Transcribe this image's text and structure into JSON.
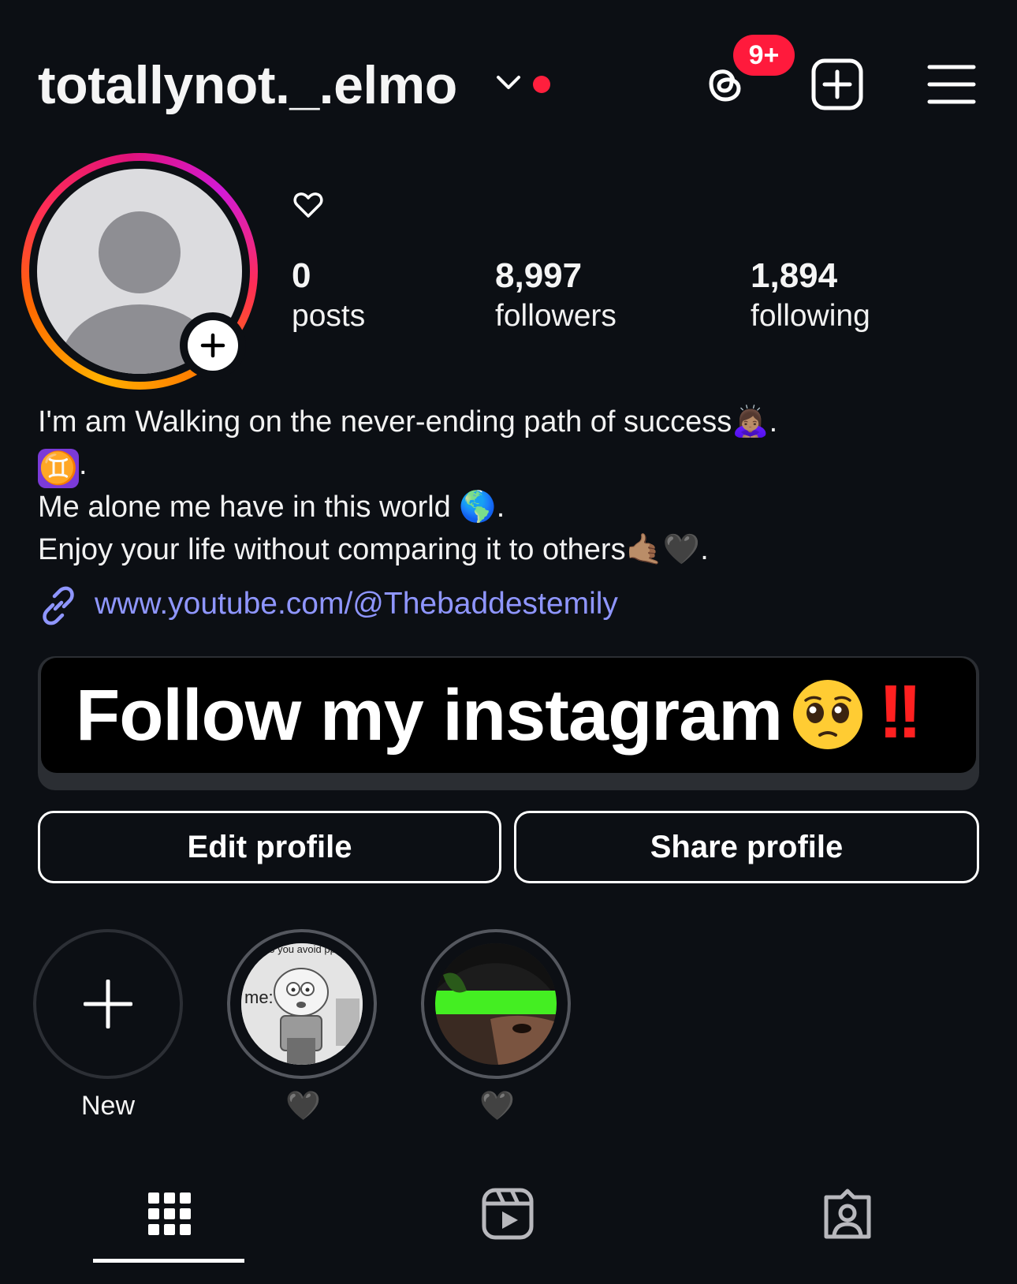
{
  "header": {
    "username": "totallynot._.elmo",
    "notification_badge": "9+",
    "icons": [
      "chevron-down-icon",
      "threads-icon",
      "create-post-icon",
      "menu-icon"
    ]
  },
  "profile": {
    "stats": [
      {
        "value": "0",
        "label": "posts"
      },
      {
        "value": "8,997",
        "label": "followers"
      },
      {
        "value": "1,894",
        "label": "following"
      }
    ],
    "bio": {
      "line1": "I'm am Walking on the never-ending path of success🙇🏽‍♀️.",
      "line2_symbol": "♊",
      "line2_suffix": ".",
      "line3": "Me alone me have in this world 🌎.",
      "line4": "Enjoy your life without comparing it to others🤙🏽🖤."
    },
    "link": "www.youtube.com/@Thebaddestemily"
  },
  "banner": {
    "text": "Follow my instagram",
    "emoji": "🥺",
    "exclaim": "!!"
  },
  "buttons": {
    "edit": "Edit profile",
    "share": "Share profile"
  },
  "highlights": [
    {
      "label": "New"
    },
    {
      "label": "🖤",
      "caption_in_image_1": "do you avoid pp",
      "caption_in_image_2": "me:"
    },
    {
      "label": "🖤"
    }
  ],
  "colors": {
    "background": "#0c0f14",
    "link": "#8f96ff",
    "badge": "#ff1a3c",
    "banner_exclaim": "#ff2020"
  }
}
